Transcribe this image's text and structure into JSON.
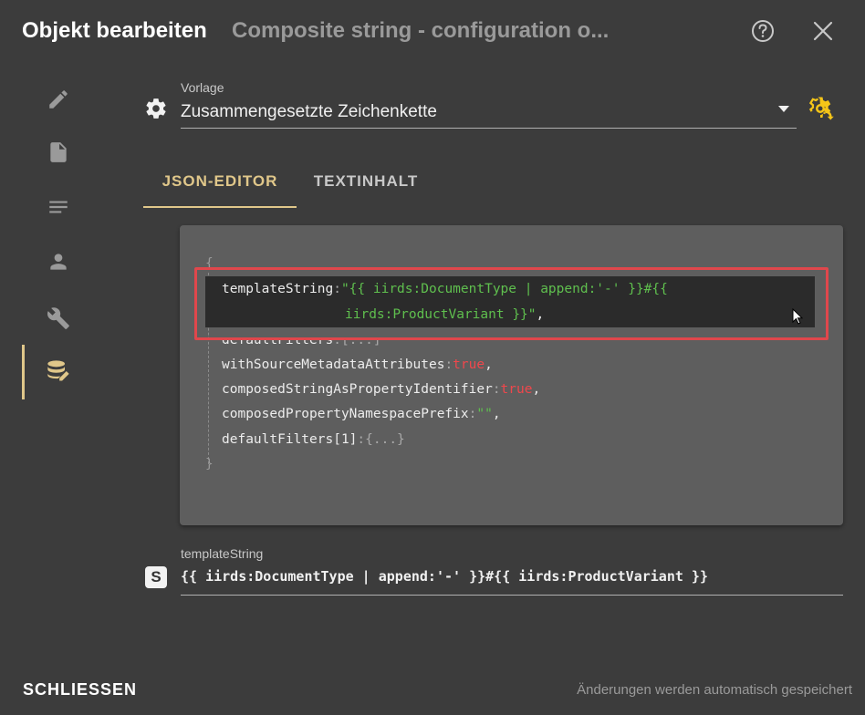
{
  "dialog": {
    "title": "Objekt bearbeiten",
    "subtitle": "Composite string - configuration o..."
  },
  "header_icons": [
    "help-circle-icon",
    "close-icon"
  ],
  "sidebar": {
    "items": [
      {
        "icon": "pencil-icon",
        "active": false
      },
      {
        "icon": "document-icon",
        "active": false
      },
      {
        "icon": "text-lines-icon",
        "active": false
      },
      {
        "icon": "person-icon",
        "active": false
      },
      {
        "icon": "tools-icon",
        "active": false
      },
      {
        "icon": "database-edit-icon",
        "active": true
      }
    ]
  },
  "vorlage": {
    "label": "Vorlage",
    "value": "Zusammengesetzte Zeichenkette"
  },
  "tabs": [
    {
      "label": "JSON-EDITOR",
      "active": true
    },
    {
      "label": "TEXTINHALT",
      "active": false
    }
  ],
  "editor": {
    "open_brace": "{",
    "close_brace": "}",
    "lines": [
      {
        "key": "templateString",
        "sep": ":",
        "value1": "\"{{ iirds:DocumentType | append:'-' }}#{{",
        "value2": "iirds:ProductVariant }}\"",
        "comma": ","
      },
      {
        "key": "defaultFilters",
        "sep": ":",
        "value": "[...]",
        "comma": ""
      },
      {
        "key": "withSourceMetadataAttributes",
        "sep": ":",
        "value": "true",
        "comma": ","
      },
      {
        "key": "composedStringAsPropertyIdentifier",
        "sep": ":",
        "value": "true",
        "comma": ","
      },
      {
        "key": "composedPropertyNamespacePrefix",
        "sep": ":",
        "value": "\"\"",
        "comma": ","
      },
      {
        "key": "defaultFilters[1]",
        "sep": ":",
        "value": "{...}",
        "comma": ""
      }
    ]
  },
  "template_string": {
    "badge": "S",
    "label": "templateString",
    "value": "{{ iirds:DocumentType | append:'-' }}#{{ iirds:ProductVariant }}"
  },
  "footer": {
    "close_label": "SCHLIESSEN",
    "autosave_text": "Änderungen werden automatisch gespeichert"
  },
  "colors": {
    "accent": "#e0c78a",
    "cog_accent": "#f5c518",
    "highlight_frame": "#e0474c",
    "string_value": "#5fbf4e",
    "boolean_value": "#f0474c"
  }
}
